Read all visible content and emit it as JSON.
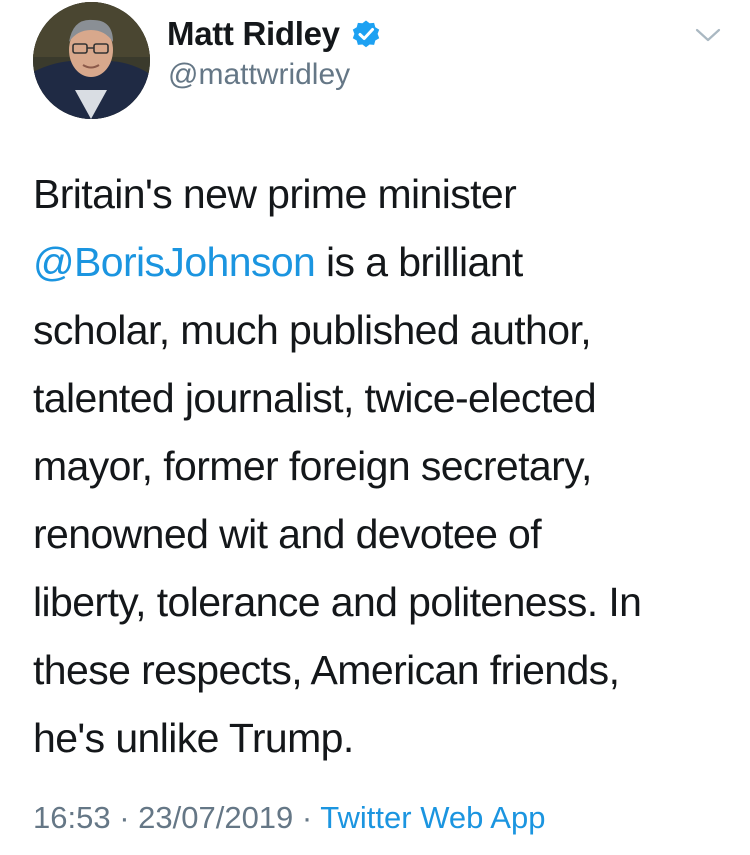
{
  "author": {
    "display_name": "Matt Ridley",
    "handle": "@mattwridley",
    "verified": true
  },
  "tweet": {
    "lines": [
      {
        "before": "Britain's new prime minister",
        "mention": "",
        "after": ""
      },
      {
        "before": "",
        "mention": "@BorisJohnson",
        "after": " is a brilliant"
      },
      {
        "before": "scholar, much published author,",
        "mention": "",
        "after": ""
      },
      {
        "before": "talented journalist, twice-elected",
        "mention": "",
        "after": ""
      },
      {
        "before": "mayor, former foreign secretary,",
        "mention": "",
        "after": ""
      },
      {
        "before": "renowned wit and devotee of",
        "mention": "",
        "after": ""
      },
      {
        "before": "liberty, tolerance and politeness. In",
        "mention": "",
        "after": ""
      },
      {
        "before": "these respects, American friends,",
        "mention": "",
        "after": ""
      },
      {
        "before": "he's unlike Trump.",
        "mention": "",
        "after": ""
      }
    ]
  },
  "meta": {
    "time": "16:53",
    "separator": " · ",
    "date": "23/07/2019",
    "source": "Twitter Web App"
  },
  "icons": {
    "verified": "verified-badge-icon",
    "menu": "chevron-down-icon"
  },
  "colors": {
    "link": "#1b95e0",
    "text": "#14171a",
    "secondary": "#657786",
    "verified": "#1da1f2"
  }
}
